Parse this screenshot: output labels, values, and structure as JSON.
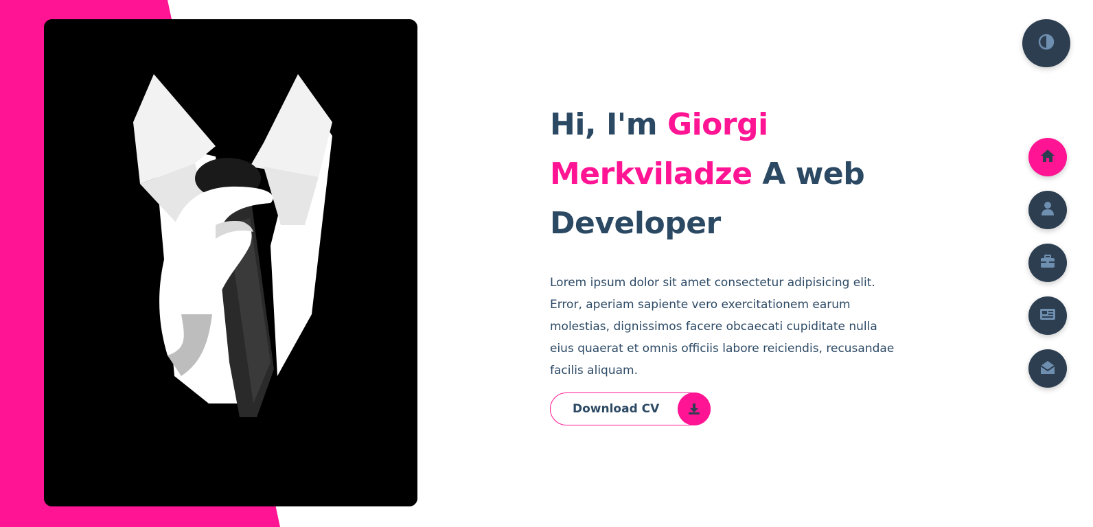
{
  "hero": {
    "greeting": "Hi, I'm ",
    "name": "Giorgi Merkviladze",
    "tagline": " A web Developer",
    "description": "Lorem ipsum dolor sit amet consectetur adipisicing elit. Error, aperiam sapiente vero exercitationem earum molestias, dignissimos facere obcaecati cupiditate nulla eius quaerat et omnis officiis labore reiciendis, recusandae facilis aliquam.",
    "download_button": {
      "label": "Download CV",
      "icon": "download-icon"
    }
  },
  "theme_toggle": {
    "icon": "half-circle-contrast-icon"
  },
  "navigation": {
    "items": [
      {
        "id": "home",
        "icon": "home-icon",
        "active": true
      },
      {
        "id": "about",
        "icon": "user-icon",
        "active": false
      },
      {
        "id": "portfolio",
        "icon": "briefcase-icon",
        "active": false
      },
      {
        "id": "blog",
        "icon": "newspaper-icon",
        "active": false
      },
      {
        "id": "contact",
        "icon": "envelope-open-icon",
        "active": false
      }
    ]
  },
  "colors": {
    "accent": "#ff1493",
    "text_dark": "#2c4964",
    "nav_dark": "#2c3e50",
    "background": "#ffffff"
  }
}
